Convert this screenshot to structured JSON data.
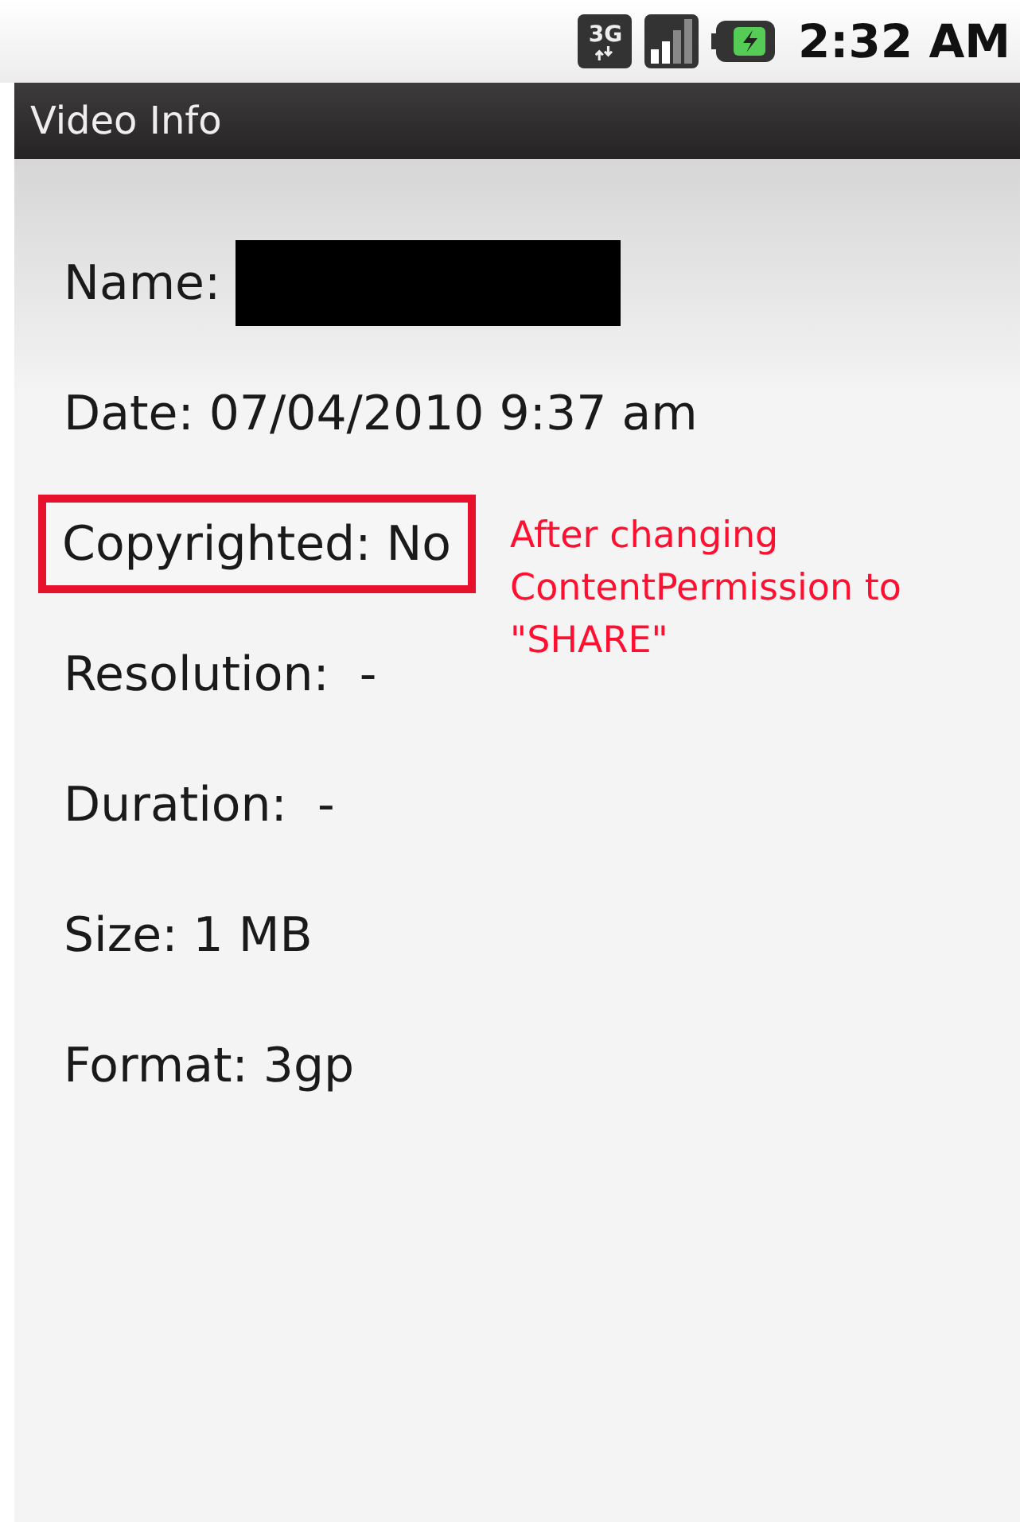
{
  "status_bar": {
    "network": "3G",
    "time": "2:32 AM"
  },
  "title_bar": {
    "title": "Video Info"
  },
  "fields": [
    {
      "text": "Name:",
      "redacted": true,
      "highlighted": false
    },
    {
      "text": "Date: 07/04/2010 9:37 am",
      "redacted": false,
      "highlighted": false
    },
    {
      "text": "Copyrighted: No",
      "redacted": false,
      "highlighted": true,
      "note": "After changing ContentPermission to \"SHARE\""
    },
    {
      "text": "Resolution:  -",
      "redacted": false,
      "highlighted": false
    },
    {
      "text": "Duration:  -",
      "redacted": false,
      "highlighted": false
    },
    {
      "text": "Size: 1 MB",
      "redacted": false,
      "highlighted": false
    },
    {
      "text": "Format: 3gp",
      "redacted": false,
      "highlighted": false
    }
  ]
}
